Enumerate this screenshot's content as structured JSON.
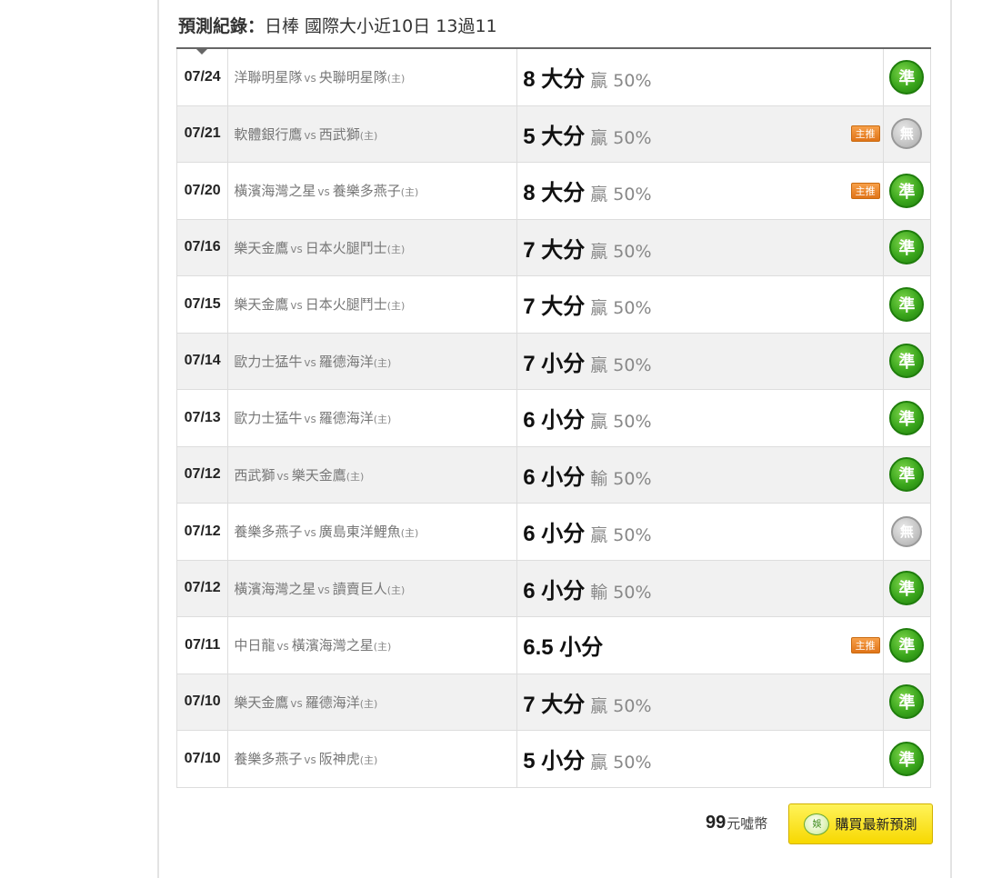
{
  "header": {
    "label": "預測紀錄：",
    "summary": "日棒 國際大小近10日 13過11"
  },
  "table": {
    "rows": [
      {
        "date": "07/24",
        "away": "洋聯明星隊",
        "vs": "vs",
        "home": "央聯明星隊",
        "home_tag": "(主)",
        "pick": "8 大分",
        "odds": "贏 50%",
        "main_pick": false,
        "result": "準",
        "result_type": "win"
      },
      {
        "date": "07/21",
        "away": "軟體銀行鷹",
        "vs": "vs",
        "home": "西武獅",
        "home_tag": "(主)",
        "pick": "5 大分",
        "odds": "贏 50%",
        "main_pick": true,
        "result": "無",
        "result_type": "void"
      },
      {
        "date": "07/20",
        "away": "橫濱海灣之星",
        "vs": "vs",
        "home": "養樂多燕子",
        "home_tag": "(主)",
        "pick": "8 大分",
        "odds": "贏 50%",
        "main_pick": true,
        "result": "準",
        "result_type": "win"
      },
      {
        "date": "07/16",
        "away": "樂天金鷹",
        "vs": "vs",
        "home": "日本火腿鬥士",
        "home_tag": "(主)",
        "pick": "7 大分",
        "odds": "贏 50%",
        "main_pick": false,
        "result": "準",
        "result_type": "win"
      },
      {
        "date": "07/15",
        "away": "樂天金鷹",
        "vs": "vs",
        "home": "日本火腿鬥士",
        "home_tag": "(主)",
        "pick": "7 大分",
        "odds": "贏 50%",
        "main_pick": false,
        "result": "準",
        "result_type": "win"
      },
      {
        "date": "07/14",
        "away": "歐力士猛牛",
        "vs": "vs",
        "home": "羅德海洋",
        "home_tag": "(主)",
        "pick": "7 小分",
        "odds": "贏 50%",
        "main_pick": false,
        "result": "準",
        "result_type": "win"
      },
      {
        "date": "07/13",
        "away": "歐力士猛牛",
        "vs": "vs",
        "home": "羅德海洋",
        "home_tag": "(主)",
        "pick": "6 小分",
        "odds": "贏 50%",
        "main_pick": false,
        "result": "準",
        "result_type": "win"
      },
      {
        "date": "07/12",
        "away": "西武獅",
        "vs": "vs",
        "home": "樂天金鷹",
        "home_tag": "(主)",
        "pick": "6 小分",
        "odds": "輸 50%",
        "main_pick": false,
        "result": "準",
        "result_type": "win"
      },
      {
        "date": "07/12",
        "away": "養樂多燕子",
        "vs": "vs",
        "home": "廣島東洋鯉魚",
        "home_tag": "(主)",
        "pick": "6 小分",
        "odds": "贏 50%",
        "main_pick": false,
        "result": "無",
        "result_type": "void"
      },
      {
        "date": "07/12",
        "away": "橫濱海灣之星",
        "vs": "vs",
        "home": "讀賣巨人",
        "home_tag": "(主)",
        "pick": "6 小分",
        "odds": "輸 50%",
        "main_pick": false,
        "result": "準",
        "result_type": "win"
      },
      {
        "date": "07/11",
        "away": "中日龍",
        "vs": "vs",
        "home": "橫濱海灣之星",
        "home_tag": "(主)",
        "pick": "6.5 小分",
        "odds": "",
        "main_pick": true,
        "result": "準",
        "result_type": "win"
      },
      {
        "date": "07/10",
        "away": "樂天金鷹",
        "vs": "vs",
        "home": "羅德海洋",
        "home_tag": "(主)",
        "pick": "7 大分",
        "odds": "贏 50%",
        "main_pick": false,
        "result": "準",
        "result_type": "win"
      },
      {
        "date": "07/10",
        "away": "養樂多燕子",
        "vs": "vs",
        "home": "阪神虎",
        "home_tag": "(主)",
        "pick": "5 小分",
        "odds": "贏 50%",
        "main_pick": false,
        "result": "準",
        "result_type": "win"
      }
    ],
    "main_pick_label": "主推"
  },
  "purchase": {
    "price": "99",
    "unit": "元噓幣",
    "button_icon": "娛",
    "button_label": "購買最新預測"
  },
  "colors": {
    "win_green": "#3aa61c",
    "void_gray": "#c4c4c4",
    "main_tag_orange": "#e07418",
    "button_yellow": "#f7d800"
  },
  "icons": {
    "win": "win-mark-icon",
    "void": "void-mark-icon",
    "buy": "coin-icon"
  }
}
